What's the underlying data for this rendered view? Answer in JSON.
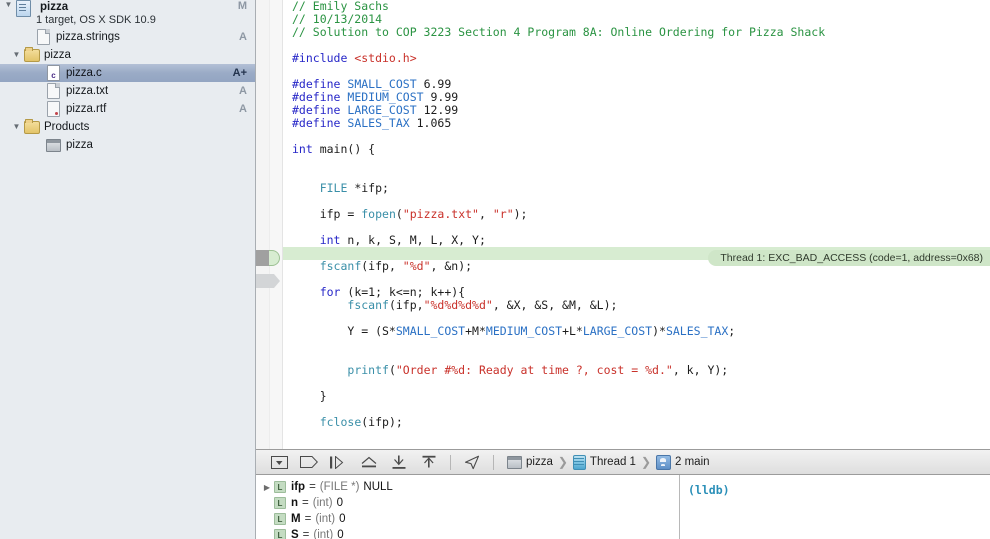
{
  "navigator": {
    "rows": [
      {
        "type": "project",
        "twisty": "▼",
        "icon": "project-icon",
        "label": "pizza",
        "subtitle": "1 target, OS X SDK 10.9",
        "status": "M",
        "indent": 0,
        "selected": false
      },
      {
        "type": "file",
        "twisty": "",
        "icon": "file-icon",
        "label": "pizza.strings",
        "status": "A",
        "indent": 1,
        "selected": false
      },
      {
        "type": "folder",
        "twisty": "▼",
        "icon": "folder-icon",
        "label": "pizza",
        "status": "",
        "indent": 1,
        "selected": false
      },
      {
        "type": "csource",
        "twisty": "",
        "icon": "c-file-icon",
        "label": "pizza.c",
        "status": "A+",
        "indent": 2,
        "selected": true
      },
      {
        "type": "file",
        "twisty": "",
        "icon": "file-icon",
        "label": "pizza.txt",
        "status": "A",
        "indent": 2,
        "selected": false
      },
      {
        "type": "rtf",
        "twisty": "",
        "icon": "rtf-file-icon",
        "label": "pizza.rtf",
        "status": "A",
        "indent": 2,
        "selected": false
      },
      {
        "type": "folder",
        "twisty": "▼",
        "icon": "folder-icon",
        "label": "Products",
        "status": "",
        "indent": 1,
        "selected": false
      },
      {
        "type": "app",
        "twisty": "",
        "icon": "app-icon",
        "label": "pizza",
        "status": "",
        "indent": 2,
        "selected": false
      }
    ]
  },
  "editor": {
    "highlighted_line_index": 19,
    "error_annotation": "Thread 1: EXC_BAD_ACCESS (code=1, address=0x68)",
    "lines": [
      [
        {
          "t": "// Emily Sachs",
          "c": "cmt"
        }
      ],
      [
        {
          "t": "// 10/13/2014",
          "c": "cmt"
        }
      ],
      [
        {
          "t": "// Solution to COP 3223 Section 4 Program 8A: Online Ordering for Pizza Shack",
          "c": "cmt"
        }
      ],
      [],
      [
        {
          "t": "#include ",
          "c": "pre"
        },
        {
          "t": "<stdio.h>",
          "c": "str"
        }
      ],
      [],
      [
        {
          "t": "#define ",
          "c": "pre"
        },
        {
          "t": "SMALL_COST",
          "c": "mac"
        },
        {
          "t": " 6.99",
          "c": "num"
        }
      ],
      [
        {
          "t": "#define ",
          "c": "pre"
        },
        {
          "t": "MEDIUM_COST",
          "c": "mac"
        },
        {
          "t": " 9.99",
          "c": "num"
        }
      ],
      [
        {
          "t": "#define ",
          "c": "pre"
        },
        {
          "t": "LARGE_COST",
          "c": "mac"
        },
        {
          "t": " 12.99",
          "c": "num"
        }
      ],
      [
        {
          "t": "#define ",
          "c": "pre"
        },
        {
          "t": "SALES_TAX",
          "c": "mac"
        },
        {
          "t": " 1.065",
          "c": "num"
        }
      ],
      [],
      [
        {
          "t": "int",
          "c": "kwb"
        },
        {
          "t": " main() {",
          "c": "plain"
        }
      ],
      [],
      [],
      [
        {
          "t": "    ",
          "c": "plain"
        },
        {
          "t": "FILE",
          "c": "fn"
        },
        {
          "t": " *ifp;",
          "c": "plain"
        }
      ],
      [],
      [
        {
          "t": "    ifp = ",
          "c": "plain"
        },
        {
          "t": "fopen",
          "c": "fn"
        },
        {
          "t": "(",
          "c": "plain"
        },
        {
          "t": "\"pizza.txt\"",
          "c": "str"
        },
        {
          "t": ", ",
          "c": "plain"
        },
        {
          "t": "\"r\"",
          "c": "str"
        },
        {
          "t": ");",
          "c": "plain"
        }
      ],
      [],
      [
        {
          "t": "    ",
          "c": "plain"
        },
        {
          "t": "int",
          "c": "kwb"
        },
        {
          "t": " n, k, S, M, L, X, Y;",
          "c": "plain"
        }
      ],
      [],
      [
        {
          "t": "    ",
          "c": "plain"
        },
        {
          "t": "fscanf",
          "c": "fn"
        },
        {
          "t": "(ifp, ",
          "c": "plain"
        },
        {
          "t": "\"%d\"",
          "c": "str"
        },
        {
          "t": ", &n);",
          "c": "plain"
        }
      ],
      [],
      [
        {
          "t": "    ",
          "c": "plain"
        },
        {
          "t": "for",
          "c": "kwb"
        },
        {
          "t": " (k=1; k<=n; k++){",
          "c": "plain"
        }
      ],
      [
        {
          "t": "        ",
          "c": "plain"
        },
        {
          "t": "fscanf",
          "c": "fn"
        },
        {
          "t": "(ifp,",
          "c": "plain"
        },
        {
          "t": "\"%d%d%d%d\"",
          "c": "str"
        },
        {
          "t": ", &X, &S, &M, &L);",
          "c": "plain"
        }
      ],
      [],
      [
        {
          "t": "        Y = (S*",
          "c": "plain"
        },
        {
          "t": "SMALL_COST",
          "c": "mac"
        },
        {
          "t": "+M*",
          "c": "plain"
        },
        {
          "t": "MEDIUM_COST",
          "c": "mac"
        },
        {
          "t": "+L*",
          "c": "plain"
        },
        {
          "t": "LARGE_COST",
          "c": "mac"
        },
        {
          "t": ")*",
          "c": "plain"
        },
        {
          "t": "SALES_TAX",
          "c": "mac"
        },
        {
          "t": ";",
          "c": "plain"
        }
      ],
      [],
      [],
      [
        {
          "t": "        ",
          "c": "plain"
        },
        {
          "t": "printf",
          "c": "fn"
        },
        {
          "t": "(",
          "c": "plain"
        },
        {
          "t": "\"Order #%d: Ready at time ?, cost = %d.\"",
          "c": "str"
        },
        {
          "t": ", k, Y);",
          "c": "plain"
        }
      ],
      [],
      [
        {
          "t": "    }",
          "c": "plain"
        }
      ],
      [],
      [
        {
          "t": "    ",
          "c": "plain"
        },
        {
          "t": "fclose",
          "c": "fn"
        },
        {
          "t": "(ifp);",
          "c": "plain"
        }
      ],
      []
    ]
  },
  "debug_bar": {
    "buttons": [
      {
        "name": "hide-debug-area-button",
        "icon": "hide-debug-area-icon"
      },
      {
        "name": "continue-button",
        "icon": "continue-icon"
      },
      {
        "name": "step-over-button",
        "icon": "step-over-icon"
      },
      {
        "name": "step-into-button",
        "icon": "step-into-icon"
      },
      {
        "name": "step-out-button",
        "icon": "step-out-icon"
      },
      {
        "name": "simulate-location-button",
        "icon": "location-arrow-icon"
      }
    ],
    "breadcrumbs": [
      {
        "icon": "target-icon",
        "label": "pizza"
      },
      {
        "icon": "thread-icon",
        "label": "Thread 1"
      },
      {
        "icon": "frame-icon",
        "label": "2 main"
      }
    ],
    "separator": "❯"
  },
  "variables": {
    "rows": [
      {
        "twisty": "▶",
        "badge": "L",
        "name": "ifp",
        "type": "(FILE *)",
        "value": "NULL"
      },
      {
        "twisty": "",
        "badge": "L",
        "name": "n",
        "type": "(int)",
        "value": "0"
      },
      {
        "twisty": "",
        "badge": "L",
        "name": "M",
        "type": "(int)",
        "value": "0"
      },
      {
        "twisty": "",
        "badge": "L",
        "name": "S",
        "type": "(int)",
        "value": "0"
      }
    ],
    "equals": "="
  },
  "console": {
    "prompt": "(lldb)"
  }
}
